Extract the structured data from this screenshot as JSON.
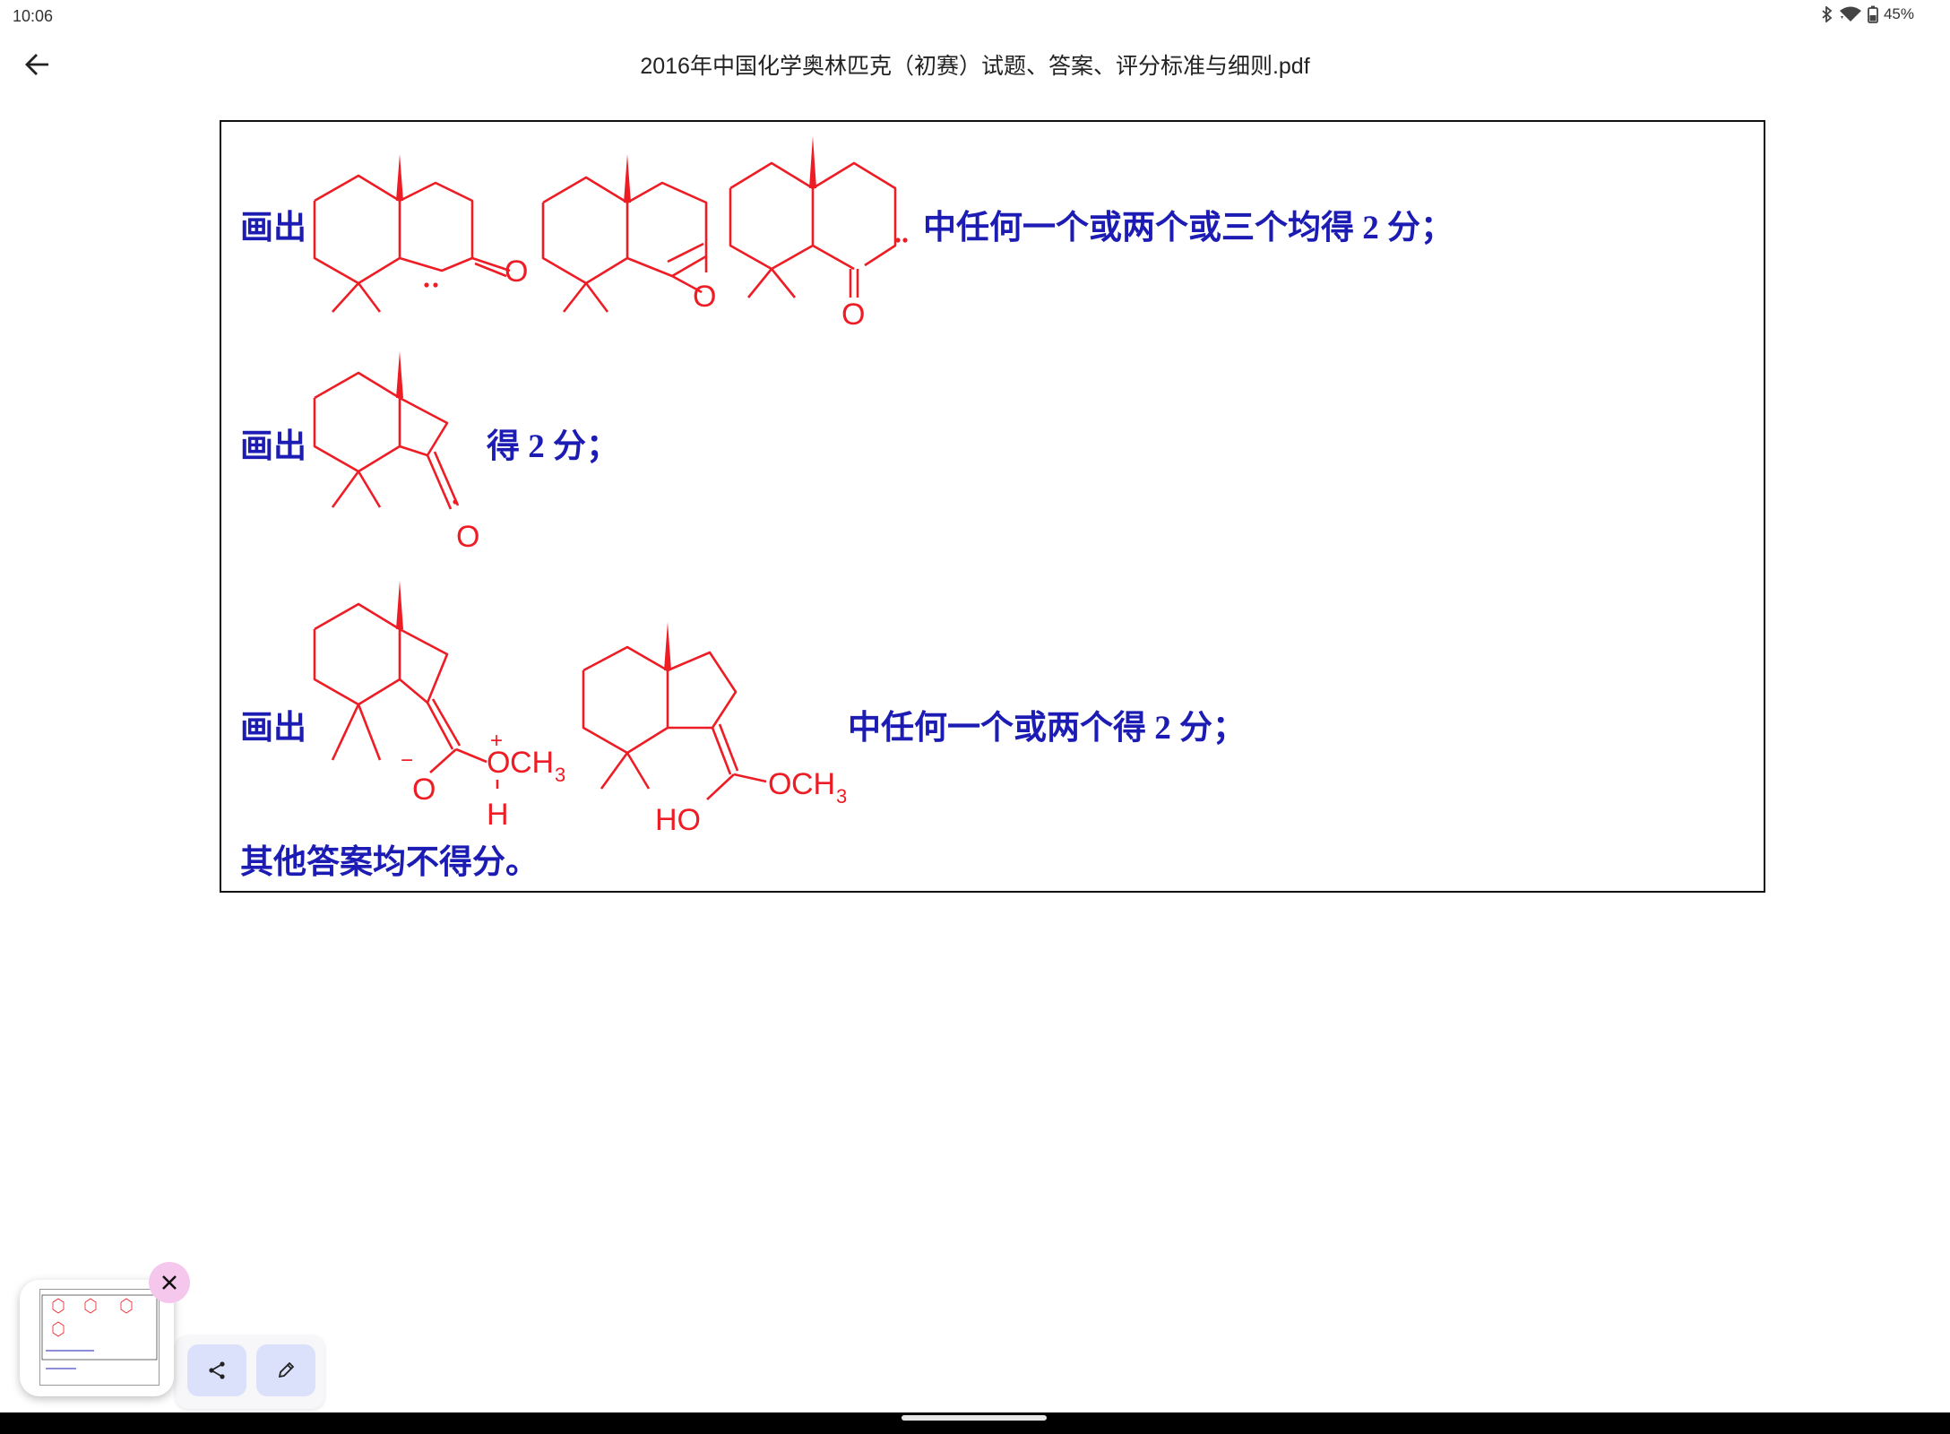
{
  "status": {
    "time": "10:06",
    "battery": "45%"
  },
  "header": {
    "title": "2016年中国化学奥林匹克（初赛）试题、答案、评分标准与细则.pdf"
  },
  "content": {
    "row1": {
      "prefix": "画出",
      "suffix": "中任何一个或两个或三个均得 2 分；"
    },
    "row2": {
      "prefix": "画出",
      "suffix": "得 2 分；"
    },
    "row3": {
      "prefix": "画出",
      "suffix": "中任何一个或两个得 2 分；"
    },
    "footer": "其他答案均不得分。"
  },
  "molecules": {
    "carbonyl_o": "O",
    "epoxide_o": "O",
    "och3_o": "O",
    "ch3": "CH",
    "sub3": "3",
    "ho": "HO",
    "h": "H",
    "o_minus": "O",
    "minus": "−",
    "plus": "+"
  },
  "icons": {
    "back": "arrow-back-icon",
    "bluetooth": "bluetooth-icon",
    "wifi": "wifi-icon",
    "battery": "battery-icon",
    "close": "close-icon",
    "share": "share-icon",
    "edit": "pencil-icon"
  },
  "colors": {
    "text_blue": "#1c1cb4",
    "structure_red": "#ee1c24"
  }
}
